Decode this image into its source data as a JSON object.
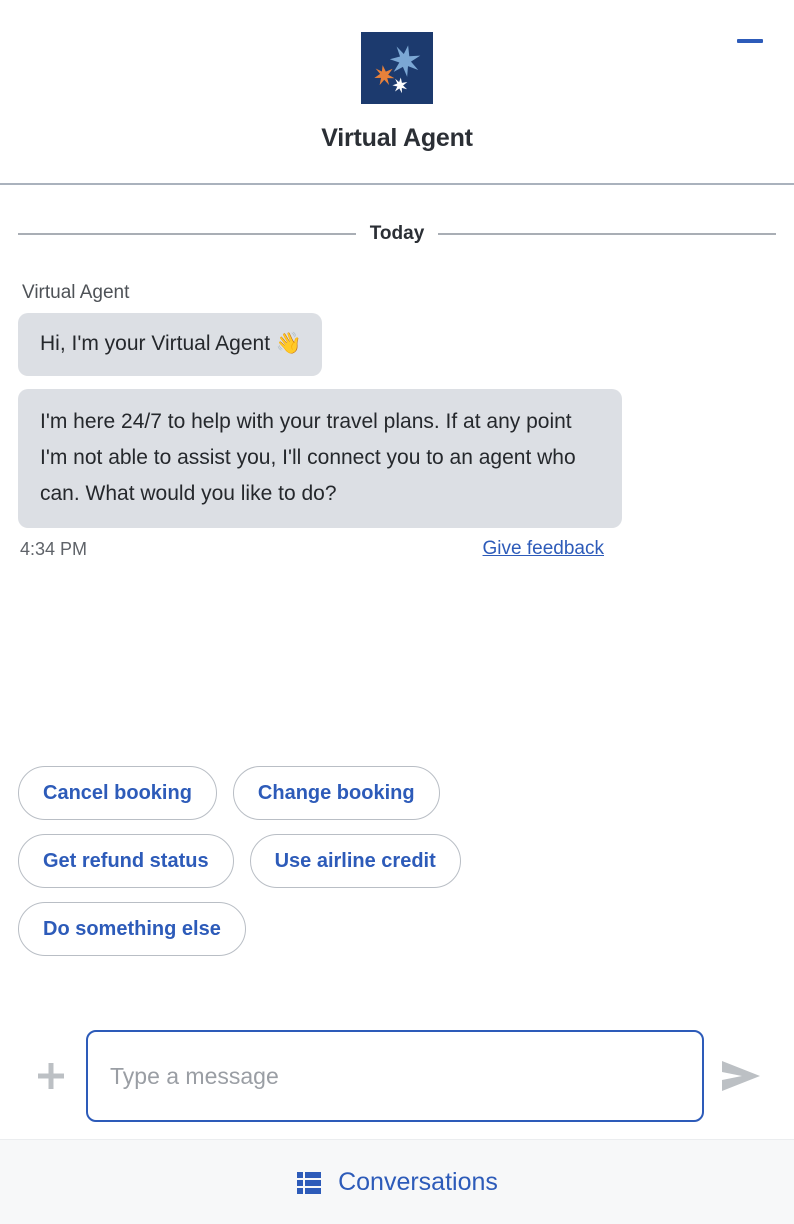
{
  "header": {
    "title": "Virtual Agent",
    "logo_icon": "three-stars-logo",
    "logo_bg": "#1c3a6e",
    "logo_star_large": "#7ba7d4",
    "logo_star_small": "#e8813a",
    "logo_star_tiny": "#ffffff",
    "minimize_icon": "minimize-icon",
    "minimize_color": "#2d5bb9"
  },
  "conversation": {
    "day_divider": "Today",
    "sender_name": "Virtual Agent",
    "messages": [
      {
        "text": "Hi, I'm your Virtual Agent 👋"
      },
      {
        "text": "I'm here 24/7 to help with your travel plans. If at any point I'm not able to assist you, I'll connect you to an agent who can. What would you like to do?"
      }
    ],
    "timestamp": "4:34 PM",
    "feedback_label": "Give feedback",
    "bubble_bg": "#dcdfe4",
    "link_color": "#2d5bb9"
  },
  "quick_replies": [
    {
      "label": "Cancel booking"
    },
    {
      "label": "Change booking"
    },
    {
      "label": "Get refund status"
    },
    {
      "label": "Use airline credit"
    },
    {
      "label": "Do something else"
    }
  ],
  "composer": {
    "attach_icon": "plus-icon",
    "placeholder": "Type a message",
    "value": "",
    "send_icon": "send-arrow-icon",
    "icon_color": "#bcc0c4",
    "focus_border": "#2d5bb9"
  },
  "footer": {
    "label": "Conversations",
    "icon": "list-icon",
    "color": "#2d5bb9",
    "background": "#f7f8f9"
  }
}
